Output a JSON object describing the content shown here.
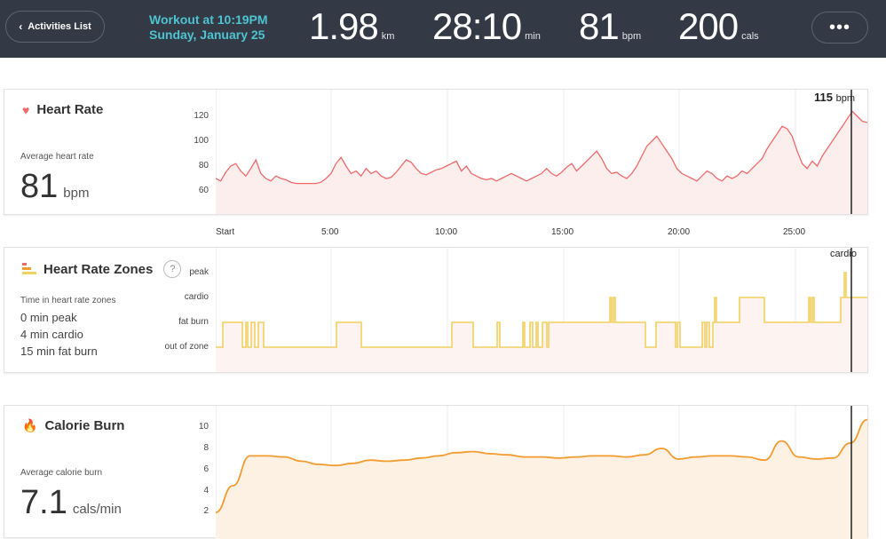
{
  "header": {
    "back_label": "Activities List",
    "workout_time": "Workout at 10:19PM",
    "workout_date": "Sunday, January 25",
    "stats": [
      {
        "value": "1.98",
        "unit": "km"
      },
      {
        "value": "28:10",
        "unit": "min"
      },
      {
        "value": "81",
        "unit": "bpm"
      },
      {
        "value": "200",
        "unit": "cals"
      }
    ],
    "more_label": "•••"
  },
  "heart_rate": {
    "title": "Heart Rate",
    "avg_label": "Average heart rate",
    "avg_value": "81",
    "avg_unit": "bpm",
    "y_ticks": [
      "120",
      "100",
      "80",
      "60"
    ],
    "cursor_value": "115",
    "cursor_unit": "bpm",
    "color": "#f06a6a",
    "x_ticks": [
      "Start",
      "5:00",
      "10:00",
      "15:00",
      "20:00",
      "25:00"
    ],
    "series": [
      70,
      68,
      75,
      80,
      82,
      76,
      72,
      78,
      85,
      74,
      70,
      68,
      72,
      70,
      69,
      67,
      66,
      66,
      66,
      66,
      66,
      67,
      70,
      74,
      82,
      87,
      80,
      74,
      76,
      72,
      78,
      74,
      76,
      72,
      70,
      71,
      75,
      80,
      85,
      83,
      78,
      74,
      73,
      75,
      77,
      78,
      80,
      82,
      84,
      76,
      80,
      74,
      72,
      70,
      69,
      70,
      68,
      70,
      72,
      74,
      72,
      70,
      68,
      70,
      72,
      74,
      78,
      74,
      72,
      75,
      79,
      82,
      76,
      80,
      84,
      88,
      92,
      86,
      78,
      74,
      75,
      72,
      70,
      74,
      80,
      88,
      96,
      100,
      104,
      98,
      92,
      86,
      78,
      74,
      72,
      70,
      68,
      72,
      76,
      74,
      70,
      68,
      72,
      70,
      72,
      76,
      74,
      78,
      82,
      86,
      94,
      100,
      106,
      112,
      110,
      104,
      92,
      82,
      78,
      84,
      80,
      88,
      94,
      100,
      106,
      112,
      118,
      124,
      120,
      116,
      115
    ]
  },
  "zones": {
    "title": "Heart Rate Zones",
    "help_label": "?",
    "desc": "Time in heart rate zones",
    "lines": [
      "0 min peak",
      "4 min cardio",
      "15 min fat burn"
    ],
    "zone_labels": [
      "peak",
      "cardio",
      "fat burn",
      "out of zone"
    ],
    "cursor_label": "cardio",
    "color": "#f2d060"
  },
  "calories": {
    "title": "Calorie Burn",
    "avg_label": "Average calorie burn",
    "avg_value": "7.1",
    "avg_unit": "cals/min",
    "y_ticks": [
      "10",
      "8",
      "6",
      "4",
      "2"
    ],
    "color": "#f29b2e",
    "series": [
      2.0,
      4.5,
      7.3,
      7.3,
      7.2,
      6.8,
      6.5,
      6.4,
      6.6,
      6.9,
      6.8,
      6.9,
      7.1,
      7.3,
      7.6,
      7.7,
      7.5,
      7.4,
      7.2,
      7.2,
      7.1,
      7.2,
      7.3,
      7.3,
      7.2,
      7.4,
      8.0,
      7.0,
      7.2,
      7.3,
      7.3,
      7.2,
      6.9,
      8.7,
      7.2,
      7.0,
      7.1,
      8.5,
      10.7
    ]
  }
}
